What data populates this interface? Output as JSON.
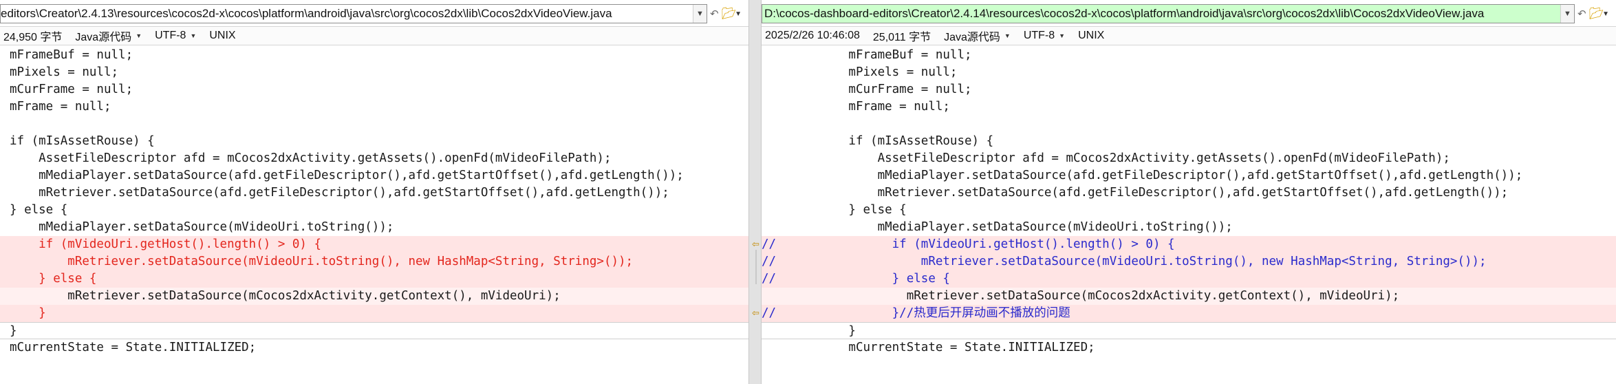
{
  "left": {
    "path": "editors\\Creator\\2.4.13\\resources\\cocos2d-x\\cocos\\platform\\android\\java\\src\\org\\cocos2dx\\lib\\Cocos2dxVideoView.java",
    "size": "24,950 字节",
    "lang": "Java源代码",
    "encoding": "UTF-8",
    "eol": "UNIX",
    "lines": [
      {
        "text": "mFrameBuf = null;",
        "type": "normal"
      },
      {
        "text": "mPixels = null;",
        "type": "normal"
      },
      {
        "text": "mCurFrame = null;",
        "type": "normal"
      },
      {
        "text": "mFrame = null;",
        "type": "normal"
      },
      {
        "text": "",
        "type": "normal"
      },
      {
        "text": "if (mIsAssetRouse) {",
        "type": "normal"
      },
      {
        "text": "    AssetFileDescriptor afd = mCocos2dxActivity.getAssets().openFd(mVideoFilePath);",
        "type": "normal"
      },
      {
        "text": "    mMediaPlayer.setDataSource(afd.getFileDescriptor(),afd.getStartOffset(),afd.getLength());",
        "type": "normal"
      },
      {
        "text": "    mRetriever.setDataSource(afd.getFileDescriptor(),afd.getStartOffset(),afd.getLength());",
        "type": "normal"
      },
      {
        "text": "} else {",
        "type": "normal"
      },
      {
        "text": "    mMediaPlayer.setDataSource(mVideoUri.toString());",
        "type": "normal"
      },
      {
        "text": "    if (mVideoUri.getHost().length() > 0) {",
        "type": "diff"
      },
      {
        "text": "        mRetriever.setDataSource(mVideoUri.toString(), new HashMap<String, String>());",
        "type": "diff"
      },
      {
        "text": "    } else {",
        "type": "diff"
      },
      {
        "text": "        mRetriever.setDataSource(mCocos2dxActivity.getContext(), mVideoUri);",
        "type": "keep"
      },
      {
        "text": "    }",
        "type": "diff"
      },
      {
        "text": "}",
        "type": "frame"
      },
      {
        "text": "mCurrentState = State.INITIALIZED;",
        "type": "normal"
      }
    ]
  },
  "right": {
    "path": "D:\\cocos-dashboard-editors\\Creator\\2.4.14\\resources\\cocos2d-x\\cocos\\platform\\android\\java\\src\\org\\cocos2dx\\lib\\Cocos2dxVideoView.java",
    "date": "2025/2/26 10:46:08",
    "size": "25,011 字节",
    "lang": "Java源代码",
    "encoding": "UTF-8",
    "eol": "UNIX",
    "lines": [
      {
        "text": "            mFrameBuf = null;",
        "type": "normal"
      },
      {
        "text": "            mPixels = null;",
        "type": "normal"
      },
      {
        "text": "            mCurFrame = null;",
        "type": "normal"
      },
      {
        "text": "            mFrame = null;",
        "type": "normal"
      },
      {
        "text": "",
        "type": "normal"
      },
      {
        "text": "            if (mIsAssetRouse) {",
        "type": "normal"
      },
      {
        "text": "                AssetFileDescriptor afd = mCocos2dxActivity.getAssets().openFd(mVideoFilePath);",
        "type": "normal"
      },
      {
        "text": "                mMediaPlayer.setDataSource(afd.getFileDescriptor(),afd.getStartOffset(),afd.getLength());",
        "type": "normal"
      },
      {
        "text": "                mRetriever.setDataSource(afd.getFileDescriptor(),afd.getStartOffset(),afd.getLength());",
        "type": "normal"
      },
      {
        "text": "            } else {",
        "type": "normal"
      },
      {
        "text": "                mMediaPlayer.setDataSource(mVideoUri.toString());",
        "type": "normal"
      },
      {
        "text": "//                if (mVideoUri.getHost().length() > 0) {",
        "type": "comment"
      },
      {
        "text": "//                    mRetriever.setDataSource(mVideoUri.toString(), new HashMap<String, String>());",
        "type": "comment"
      },
      {
        "text": "//                } else {",
        "type": "comment"
      },
      {
        "text": "                    mRetriever.setDataSource(mCocos2dxActivity.getContext(), mVideoUri);",
        "type": "keep"
      },
      {
        "text": "//                }//热更后开屏动画不播放的问题",
        "type": "comment"
      },
      {
        "text": "            }",
        "type": "frame"
      },
      {
        "text": "            mCurrentState = State.INITIALIZED;",
        "type": "normal"
      }
    ]
  },
  "icons": {
    "back": "undo-arrow-icon",
    "open": "folder-open-icon",
    "dropdown": "chevron-down-icon",
    "diff_marker": "left-arrow-icon"
  },
  "colors": {
    "diff_bg": "#ffe4e4",
    "diff_text": "#e3261d",
    "comment_text": "#2a2acc",
    "path_highlight": "#ccffcc"
  }
}
